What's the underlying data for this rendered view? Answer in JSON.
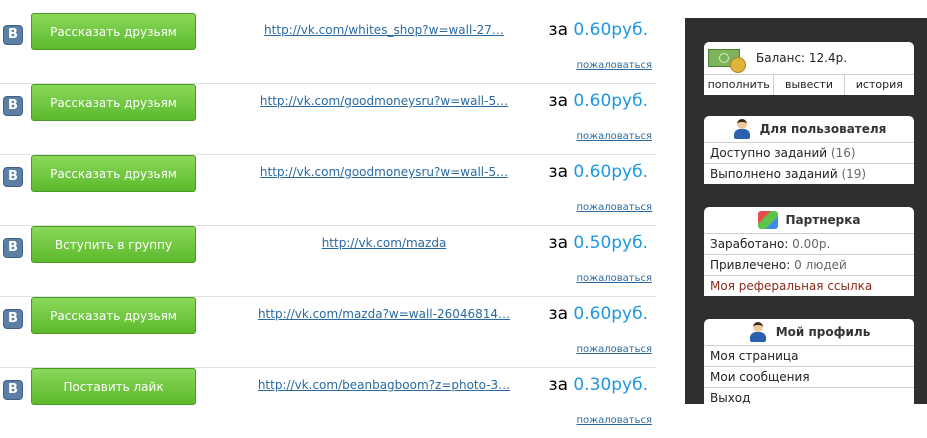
{
  "tasks": [
    {
      "button": "Рассказать друзьям",
      "link": "http://vk.com/whites_shop?w=wall-27…",
      "price_prefix": "за",
      "price": "0.60руб.",
      "complain": "пожаловаться"
    },
    {
      "button": "Рассказать друзьям",
      "link": "http://vk.com/goodmoneysru?w=wall-5…",
      "price_prefix": "за",
      "price": "0.60руб.",
      "complain": "пожаловаться"
    },
    {
      "button": "Рассказать друзьям",
      "link": "http://vk.com/goodmoneysru?w=wall-5…",
      "price_prefix": "за",
      "price": "0.60руб.",
      "complain": "пожаловаться"
    },
    {
      "button": "Вступить в группу",
      "link": "http://vk.com/mazda",
      "price_prefix": "за",
      "price": "0.50руб.",
      "complain": "пожаловаться"
    },
    {
      "button": "Рассказать друзьям",
      "link": "http://vk.com/mazda?w=wall-26046814…",
      "price_prefix": "за",
      "price": "0.60руб.",
      "complain": "пожаловаться"
    },
    {
      "button": "Поставить лайк",
      "link": "http://vk.com/beanbagboom?z=photo-3…",
      "price_prefix": "за",
      "price": "0.30руб.",
      "complain": "пожаловаться"
    }
  ],
  "vk_logo": "B",
  "balance": {
    "label": "Баланс: 12.4р.",
    "actions": [
      "пополнить",
      "вывести",
      "история"
    ]
  },
  "user_box": {
    "title": "Для пользователя",
    "available_label": "Доступно заданий",
    "available_count": "(16)",
    "done_label": "Выполнено заданий",
    "done_count": "(19)"
  },
  "partner_box": {
    "title": "Партнерка",
    "earned_label": "Заработано:",
    "earned_value": "0.00р.",
    "invited_label": "Привлечено:",
    "invited_value": "0 людей",
    "ref_link": "Моя реферальная ссылка"
  },
  "profile_box": {
    "title": "Мой профиль",
    "my_page": "Моя страница",
    "my_messages": "Мои сообщения",
    "logout": "Выход"
  }
}
